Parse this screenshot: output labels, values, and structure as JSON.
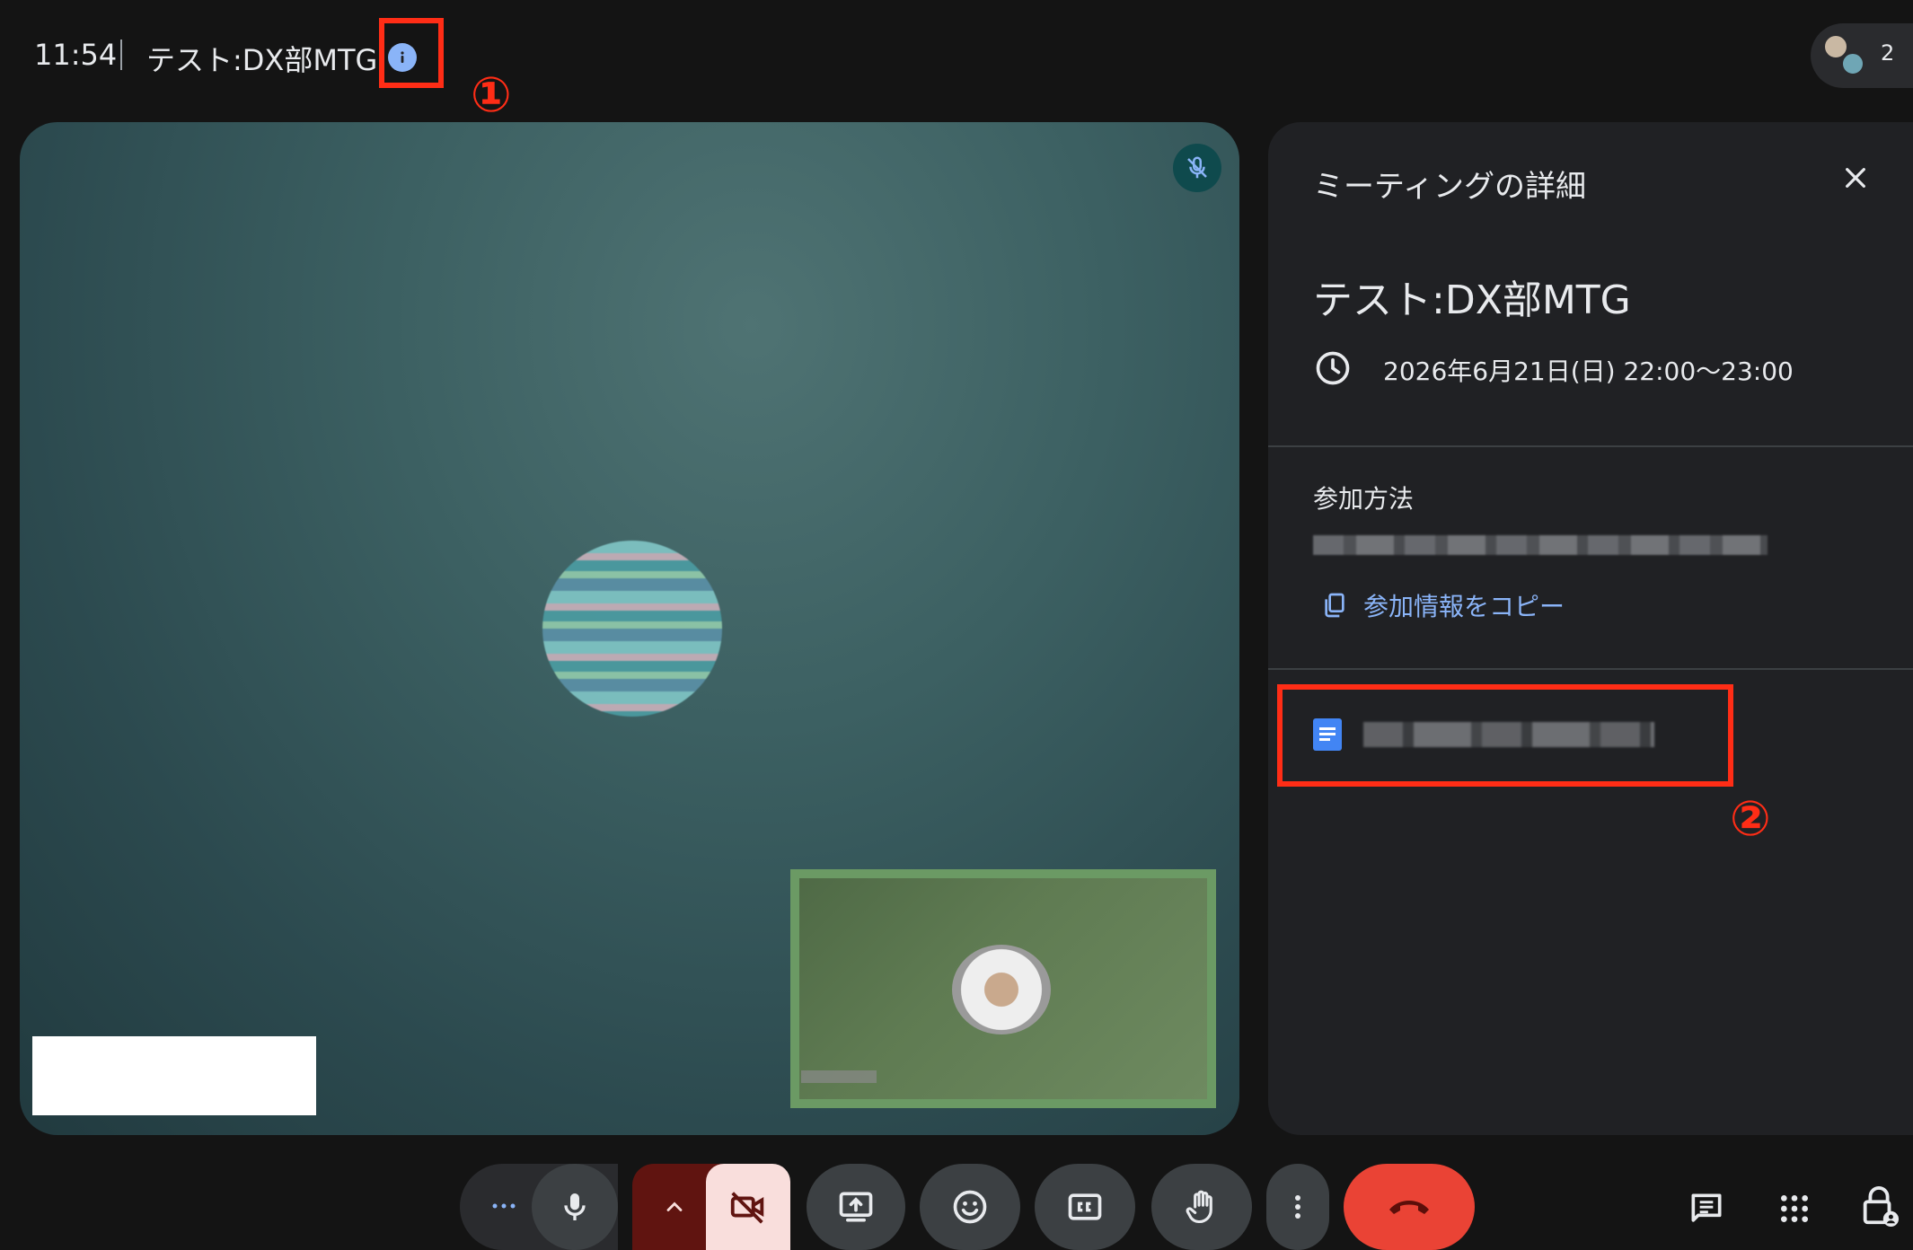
{
  "topbar": {
    "time": "11:54",
    "title": "テスト:DX部MTG",
    "participants_count": "2"
  },
  "annotations": {
    "marker_1": "①",
    "marker_2": "②",
    "color": "#ff2d16"
  },
  "panel": {
    "title": "ミーティングの詳細",
    "meeting_name": "テスト:DX部MTG",
    "meeting_time": "2026年6月21日(日) 22:00〜23:00",
    "join_heading": "参加方法",
    "copy_label": "参加情報をコピー"
  },
  "colors": {
    "accent": "#8ab4f8",
    "hangup": "#ea4335",
    "camera_off_bg": "#f9dedc",
    "panel_bg": "#202124"
  },
  "icons": {
    "info": "info-icon",
    "close": "close-icon",
    "clock": "clock-icon",
    "copy": "copy-icon",
    "doc": "google-doc-icon",
    "mic": "microphone-icon",
    "camera_off": "camera-off-icon",
    "present": "present-screen-icon",
    "emoji": "emoji-icon",
    "cc": "closed-captions-icon",
    "hand": "raise-hand-icon",
    "more": "more-vert-icon",
    "hangup": "hang-up-icon",
    "chat": "chat-icon",
    "activities": "activities-grid-icon",
    "host_controls": "host-controls-lock-icon"
  }
}
